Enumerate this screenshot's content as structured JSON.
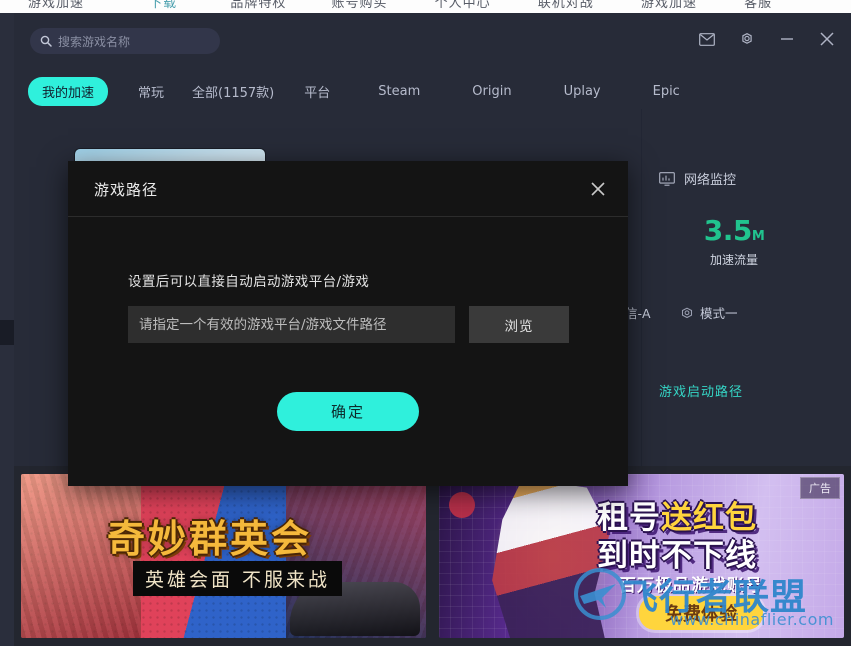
{
  "background_window": {
    "strip_items": [
      "游戏加速",
      "下载",
      "品牌特权",
      "账号购买",
      "个人中心",
      "联机对战",
      "游戏加速",
      "客服"
    ]
  },
  "header": {
    "search": {
      "placeholder": "搜索游戏名称",
      "value": "",
      "icon": "search-icon"
    },
    "window_controls": [
      {
        "name": "mail-icon",
        "label": "邮件"
      },
      {
        "name": "gear-icon",
        "label": "设置"
      },
      {
        "name": "minimize-icon",
        "label": "最小化"
      },
      {
        "name": "close-icon",
        "label": "关闭"
      }
    ]
  },
  "nav": {
    "tabs": [
      {
        "label": "我的加速",
        "active": true
      },
      {
        "label": "常玩",
        "active": false
      },
      {
        "label": "全部(1157款)",
        "active": false
      },
      {
        "label": "平台",
        "active": false
      },
      {
        "label": "Steam",
        "active": false
      },
      {
        "label": "Origin",
        "active": false
      },
      {
        "label": "Uplay",
        "active": false
      },
      {
        "label": "Epic",
        "active": false
      }
    ]
  },
  "right_panel": {
    "monitor_label": "网络监控",
    "monitor_icon": "network-monitor-icon",
    "traffic_value": "3.5",
    "traffic_unit": "M",
    "traffic_label": "加速流量",
    "server_fragment": "信-A",
    "mode_icon": "mode-icon",
    "mode_label": "模式一",
    "launch_path_link": "游戏启动路径"
  },
  "dialog": {
    "title": "游戏路径",
    "close_icon": "close-icon",
    "hint": "设置后可以直接自动启动游戏平台/游戏",
    "path_placeholder": "请指定一个有效的游戏平台/游戏文件路径",
    "path_value": "",
    "browse_label": "浏览",
    "confirm_label": "确定"
  },
  "banners": {
    "left": {
      "title": "奇妙群英会",
      "subtitle": "英雄会面 不服来战"
    },
    "right": {
      "line1_a": "租号",
      "line1_b": "送红包",
      "line2": "到时不下线",
      "line3": "百万极品游戏账号",
      "cta": "免费体验",
      "ad_badge": "广告"
    }
  },
  "watermark": {
    "text": "飞行者联盟",
    "url": "www.chinaflier.com",
    "logo": "plane-logo-icon"
  },
  "colors": {
    "accent": "#2ff0dc",
    "app_bg": "#272b38",
    "dialog_bg": "#141414",
    "traffic_green": "#21c48e",
    "link_teal": "#35d6c6"
  }
}
